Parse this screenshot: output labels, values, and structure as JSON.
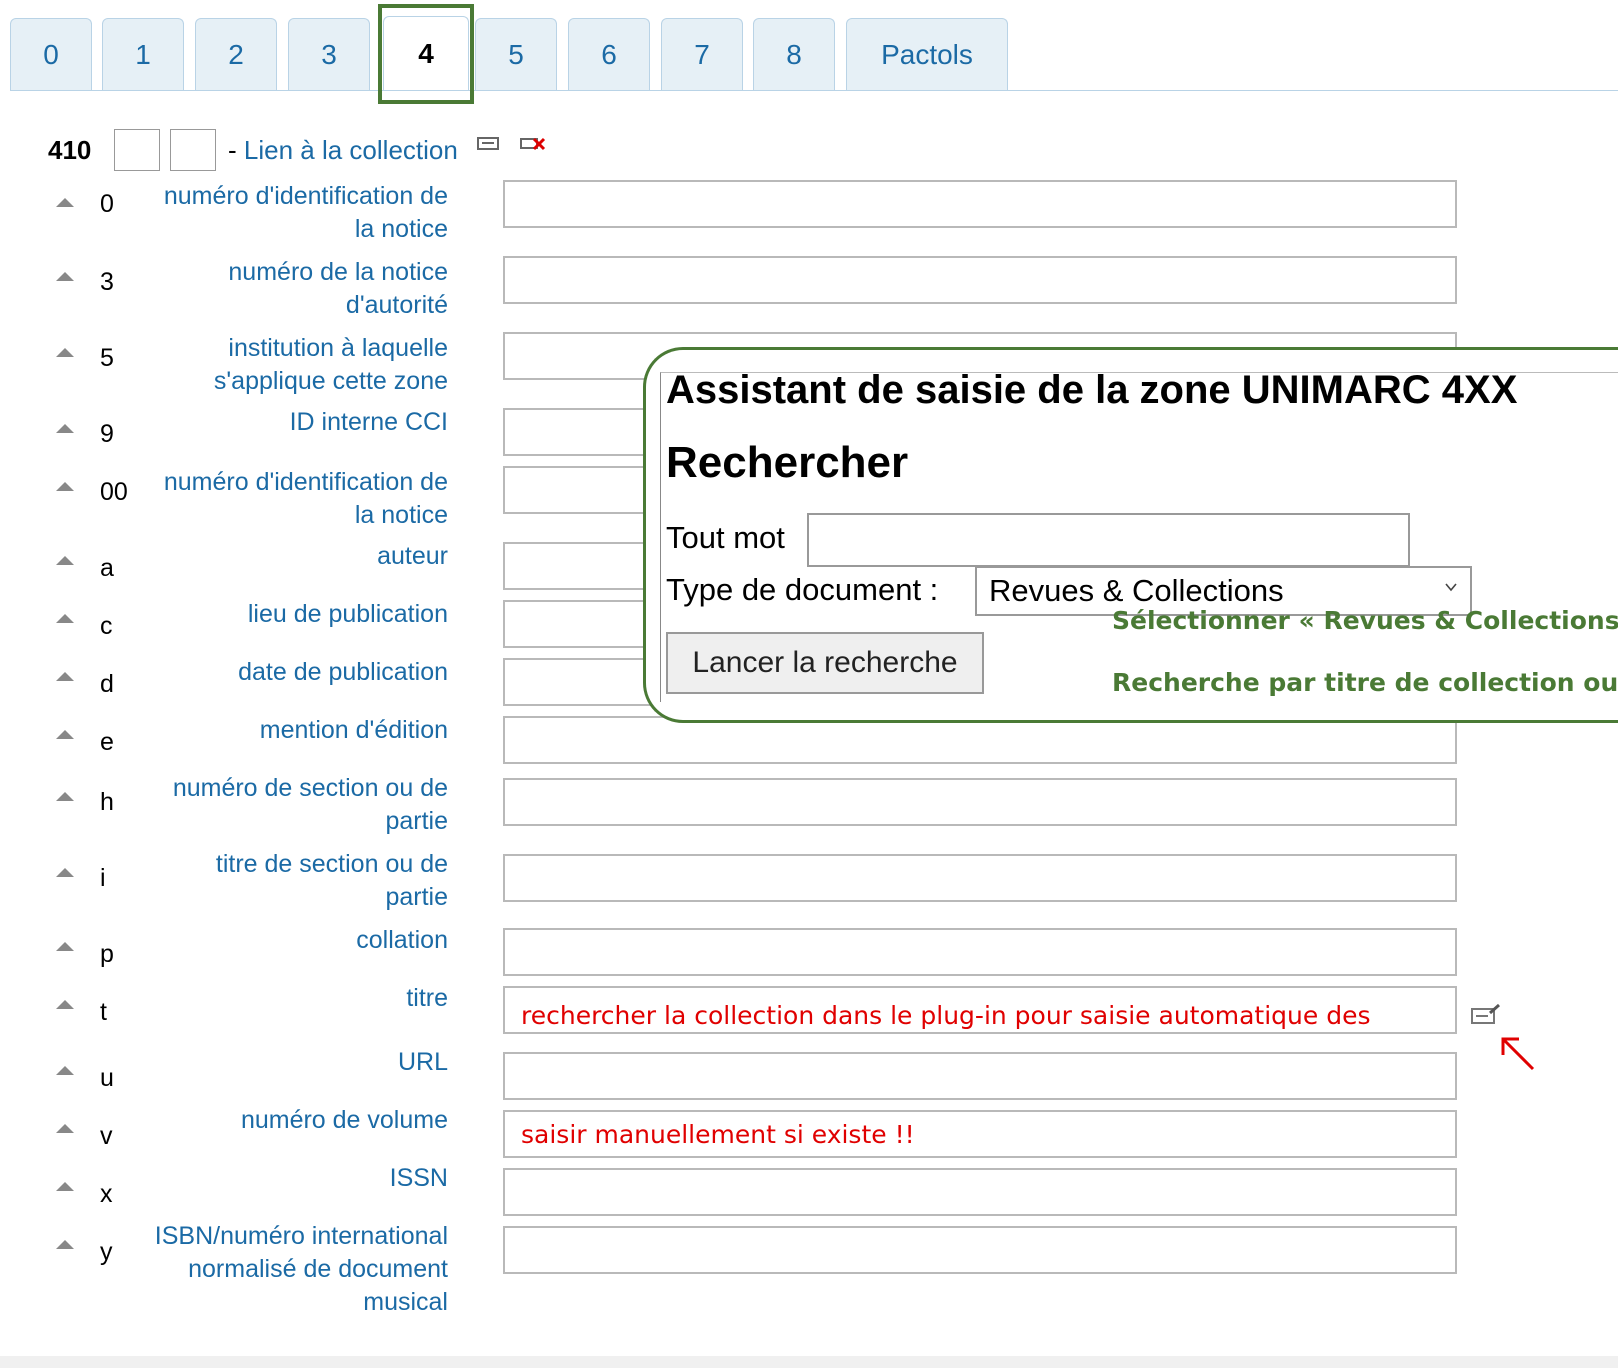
{
  "tabs": [
    {
      "label": "0"
    },
    {
      "label": "1"
    },
    {
      "label": "2"
    },
    {
      "label": "3"
    },
    {
      "label": "4",
      "active": true
    },
    {
      "label": "5"
    },
    {
      "label": "6"
    },
    {
      "label": "7"
    },
    {
      "label": "8"
    },
    {
      "label": "Pactols"
    }
  ],
  "field": {
    "tag": "410",
    "dash": "-",
    "description": "Lien à la collection",
    "clone_icon": "clone-field-icon",
    "delete_icon": "delete-field-icon"
  },
  "subfields": [
    {
      "code": "0",
      "label": "numéro d'identification de la notice",
      "value": ""
    },
    {
      "code": "3",
      "label": "numéro de la notice d'autorité",
      "value": ""
    },
    {
      "code": "5",
      "label": "institution à laquelle s'applique cette zone",
      "value": ""
    },
    {
      "code": "9",
      "label": "ID interne CCI",
      "value": ""
    },
    {
      "code": "00",
      "label": "numéro d'identification de la notice",
      "value": ""
    },
    {
      "code": "a",
      "label": "auteur",
      "value": ""
    },
    {
      "code": "c",
      "label": "lieu de publication",
      "value": ""
    },
    {
      "code": "d",
      "label": "date de publication",
      "value": ""
    },
    {
      "code": "e",
      "label": "mention d'édition",
      "value": ""
    },
    {
      "code": "h",
      "label": "numéro de section ou de partie",
      "value": ""
    },
    {
      "code": "i",
      "label": "titre de section ou de partie",
      "value": ""
    },
    {
      "code": "p",
      "label": "collation",
      "value": ""
    },
    {
      "code": "t",
      "label": "titre",
      "value": "rechercher la collection dans le plug-in pour saisie automatique des"
    },
    {
      "code": "u",
      "label": "URL",
      "value": ""
    },
    {
      "code": "v",
      "label": "numéro de volume",
      "value": "saisir manuellement si existe !!"
    },
    {
      "code": "x",
      "label": "ISSN",
      "value": ""
    },
    {
      "code": "y",
      "label": "ISBN/numéro international normalisé de document musical",
      "value": ""
    }
  ],
  "assistant": {
    "title": "Assistant de saisie de la zone UNIMARC 4XX",
    "subtitle": "Rechercher",
    "any_word_label": "Tout mot",
    "any_word_value": "",
    "doc_type_label": "Type de document :",
    "doc_type_selected": "Revues & Collections",
    "search_button": "Lancer la recherche",
    "note1": "Sélectionner « Revues & Collections »",
    "note2": "Recherche par titre de collection ou ISSN"
  },
  "colors": {
    "link_blue": "#1b6aa5",
    "highlight_green": "#4a7a35",
    "annotation_red": "#e00000",
    "tab_bg": "#e6f0f6"
  }
}
